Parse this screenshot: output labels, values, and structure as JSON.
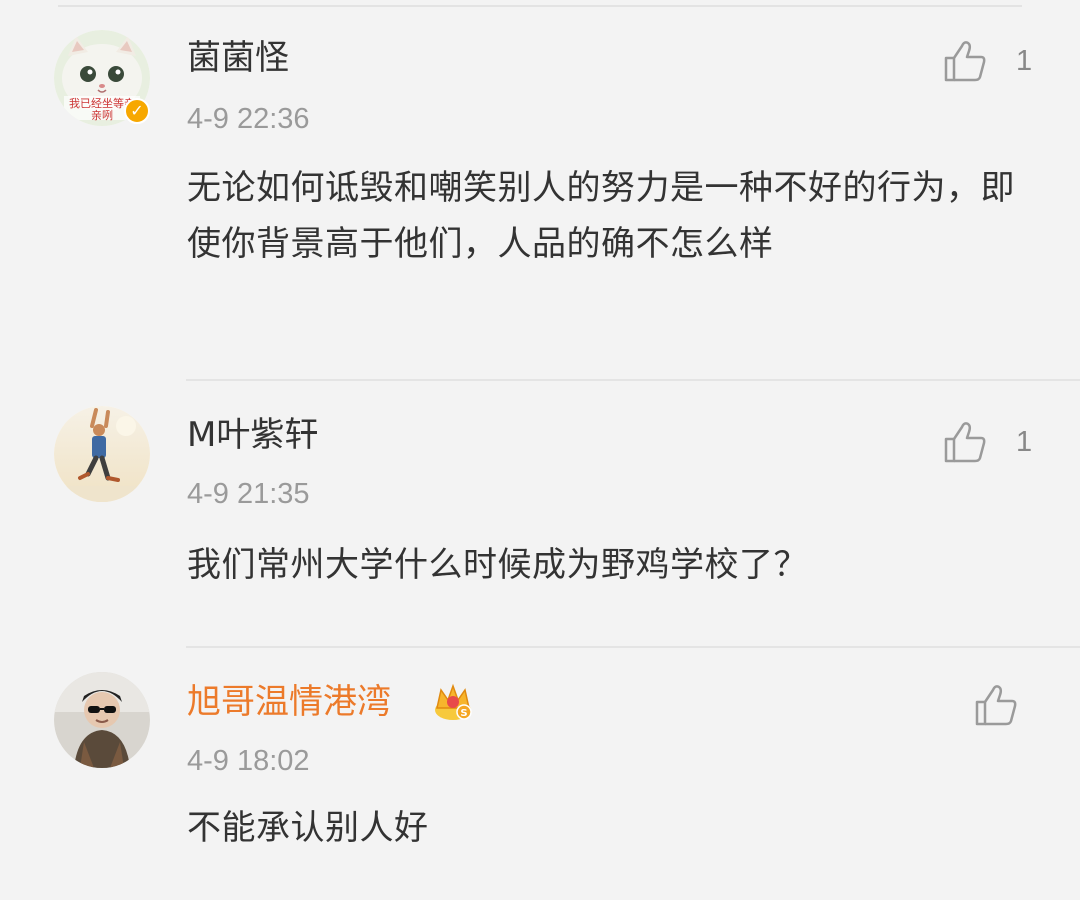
{
  "comments": [
    {
      "username": "菌菌怪",
      "timestamp": "4-9 22:36",
      "text": "无论如何诋毁和嘲笑别人的努力是一种不好的行为，即使你背景高于他们，人品的确不怎么样",
      "like_count": "1",
      "avatar_caption": "我已经坐等亲亲咧",
      "verified": true
    },
    {
      "username": "M叶紫轩",
      "timestamp": "4-9 21:35",
      "text": "我们常州大学什么时候成为野鸡学校了？",
      "like_count": "1"
    },
    {
      "username": "旭哥温情港湾",
      "timestamp": "4-9 18:02",
      "text": "不能承认别人好",
      "like_count": "",
      "badge": "crown-vip",
      "username_color": "#ec7a2a"
    }
  ],
  "icons": {
    "like": "thumbs-up-outline-icon",
    "verified": "verified-badge-icon",
    "vip": "crown-badge-icon"
  }
}
